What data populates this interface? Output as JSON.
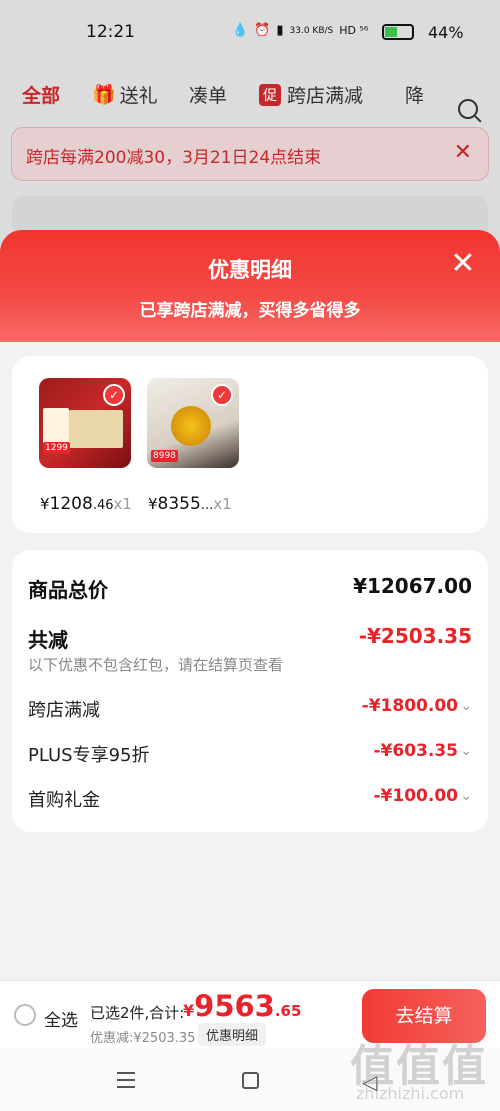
{
  "status_bar": {
    "time": "12:21",
    "network_speed": "33.0 KB/S",
    "icons_text": "HD ⁵⁶",
    "battery": "44%"
  },
  "background_page": {
    "tabs": [
      {
        "label": "全部"
      },
      {
        "label": "送礼"
      },
      {
        "label": "凑单"
      },
      {
        "label": "跨店满减",
        "badge": "促"
      },
      {
        "label": "降"
      }
    ],
    "notice": "跨店每满200减30，3月21日24点结束",
    "notice_close": "✕"
  },
  "sheet": {
    "title": "优惠明细",
    "subtitle": "已享跨店满减，买得多省得多",
    "close": "✕",
    "products": [
      {
        "price_symbol": "¥",
        "price_main": "1208",
        "price_dec": ".46",
        "qty": "x1",
        "tag": "1299"
      },
      {
        "price_symbol": "¥",
        "price_main": "8355",
        "price_dec": "...",
        "qty": "x1",
        "tag": "8998"
      }
    ],
    "summary": {
      "total_label": "商品总价",
      "total_value": "¥12067.00",
      "reduce_label": "共减",
      "reduce_value": "-¥2503.35",
      "note": "以下优惠不包含红包，请在结算页查看",
      "items": [
        {
          "label": "跨店满减",
          "value": "-¥1800.00"
        },
        {
          "label": "PLUS专享95折",
          "value": "-¥603.35"
        },
        {
          "label": "首购礼金",
          "value": "-¥100.00"
        }
      ]
    }
  },
  "bottom_bar": {
    "select_all": "全选",
    "selected_total_label": "已选2件,合计:",
    "price_symbol": "¥",
    "price_int": "9563",
    "price_dec": ".65",
    "discount_line": "优惠减:¥2503.35",
    "detail_button": "优惠明细",
    "checkout_button": "去结算"
  },
  "watermark": {
    "big": "值值值",
    "small": "zhizhizhi.com"
  },
  "colors": {
    "accent": "#e8232a",
    "header_red": "#f2342e"
  }
}
